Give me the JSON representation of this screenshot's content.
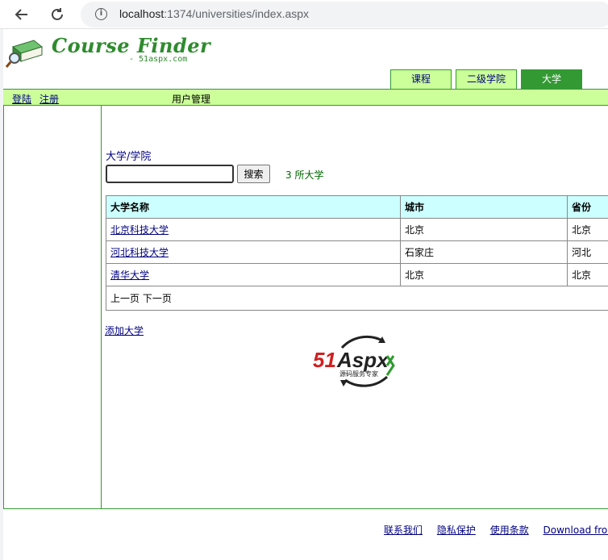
{
  "browser": {
    "url_host": "localhost",
    "url_path": ":1374/universities/index.aspx",
    "back_icon": "arrow-left",
    "reload_icon": "reload"
  },
  "logo": {
    "title": "Course Finder",
    "subtitle": "- 51aspx.com",
    "icon": "book-magnifier"
  },
  "tabs": [
    {
      "label": "课程",
      "active": false
    },
    {
      "label": "二级学院",
      "active": false
    },
    {
      "label": "大学",
      "active": true
    }
  ],
  "topbar": {
    "login": "登陆",
    "register": "注册",
    "admin": "用户管理"
  },
  "section": {
    "title": "大学/学院",
    "search_value": "",
    "search_button": "搜索",
    "count_text": "3 所大学"
  },
  "table": {
    "headers": [
      "大学名称",
      "城市",
      "省份"
    ],
    "rows": [
      [
        "北京科技大学",
        "北京",
        "北京"
      ],
      [
        "河北科技大学",
        "石家庄",
        "河北"
      ],
      [
        "清华大学",
        "北京",
        "北京"
      ]
    ],
    "pager": "上一页 下一页"
  },
  "add_link": "添加大学",
  "badge": {
    "brand": "51Aspx",
    "tagline": "源码服务专家"
  },
  "footer": {
    "links": [
      "联系我们",
      "隐私保护",
      "使用条款",
      "Download from"
    ]
  },
  "colors": {
    "brand_green": "#339933",
    "light_green": "#ccff99",
    "header_cyan": "#ccffff",
    "link_navy": "#000080"
  }
}
